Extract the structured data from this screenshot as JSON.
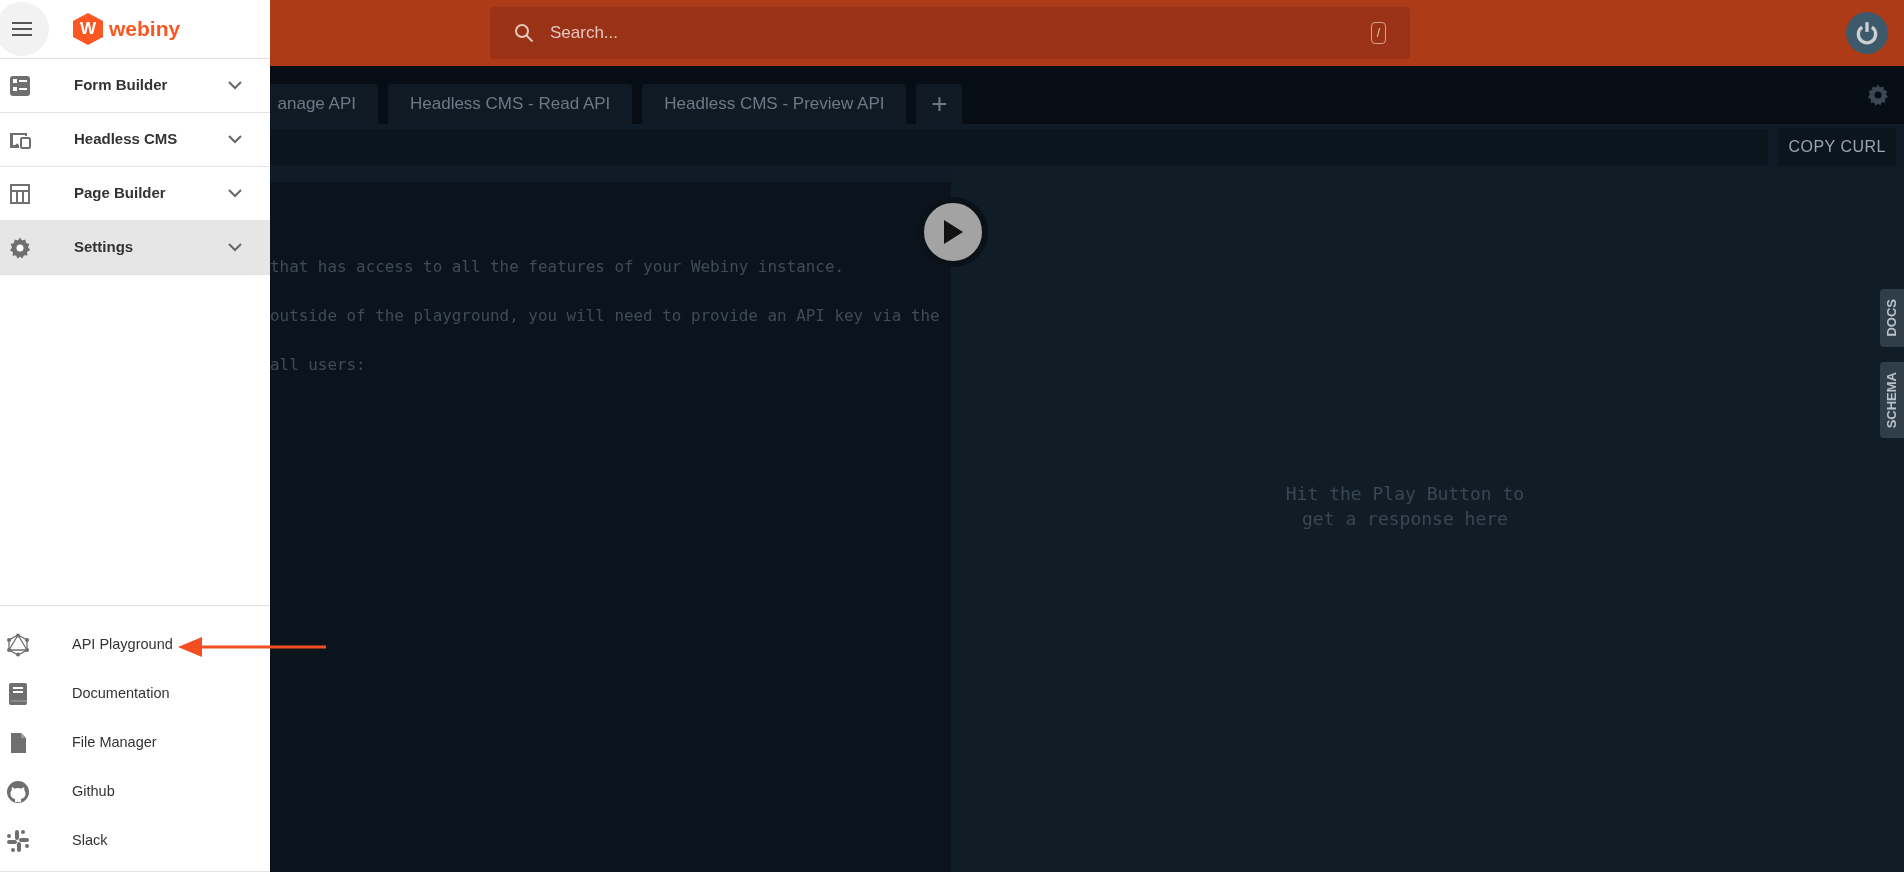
{
  "header": {
    "logo_mark": "W",
    "logo_text": "webiny",
    "search": {
      "placeholder": "Search...",
      "shortcut": "/"
    }
  },
  "sidebar": {
    "menu": [
      {
        "label": "Form Builder",
        "expanded": false,
        "selected": false
      },
      {
        "label": "Headless CMS",
        "expanded": false,
        "selected": false
      },
      {
        "label": "Page Builder",
        "expanded": false,
        "selected": false
      },
      {
        "label": "Settings",
        "expanded": false,
        "selected": true
      }
    ],
    "links": [
      {
        "label": "API Playground"
      },
      {
        "label": "Documentation"
      },
      {
        "label": "File Manager"
      },
      {
        "label": "Github"
      },
      {
        "label": "Slack"
      }
    ]
  },
  "playground": {
    "tabs": [
      {
        "label": "anage API"
      },
      {
        "label": "Headless CMS - Read API"
      },
      {
        "label": "Headless CMS - Preview API"
      }
    ],
    "add_tab": "+",
    "copy_curl": "COPY CURL",
    "editor_lines": [
      "that has access to all the features of your Webiny instance.",
      "outside of the playground, you will need to provide an API key via the",
      "all users:"
    ],
    "response_placeholder": "Hit the Play Button to get a response here",
    "side_tabs": [
      "DOCS",
      "SCHEMA"
    ]
  },
  "annotation": {
    "kind": "arrow"
  }
}
